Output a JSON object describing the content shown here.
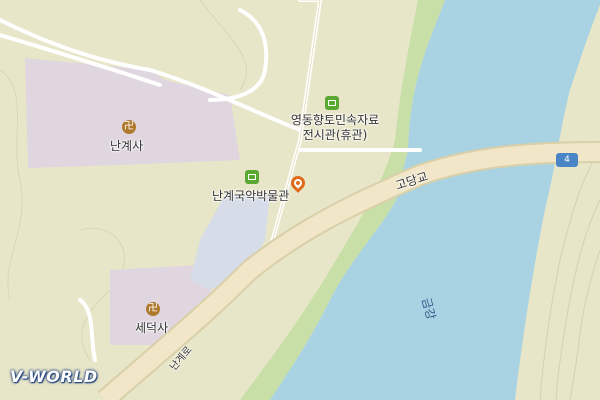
{
  "map": {
    "colors": {
      "land": "#e8e6c8",
      "river": "#a9d3e3",
      "riverbank": "#c8dfa8",
      "road_main": "#f1e7c8",
      "road_minor": "#ffffff",
      "temple_area": "#e0d6e0",
      "facility_area": "#d6dce8"
    },
    "places": [
      {
        "id": "museum_yeongdong",
        "name_line1": "영동향토민속자료",
        "name_line2": "전시관(휴관)",
        "icon": "museum-icon"
      },
      {
        "id": "temple_nangye",
        "name": "난계사",
        "icon": "temple-icon"
      },
      {
        "id": "museum_nangye",
        "name": "난계국악박물관",
        "icon": "museum-icon"
      },
      {
        "id": "temple_sedeok",
        "name": "세덕사",
        "icon": "temple-icon"
      }
    ],
    "roads": [
      {
        "id": "bridge",
        "name": "고당교"
      },
      {
        "id": "nangye_ro",
        "name": "난계로"
      }
    ],
    "river": {
      "name": "금강"
    },
    "route_shield": {
      "number": "4"
    },
    "temple_glyph": "卍",
    "logo": "V-WORLD"
  }
}
